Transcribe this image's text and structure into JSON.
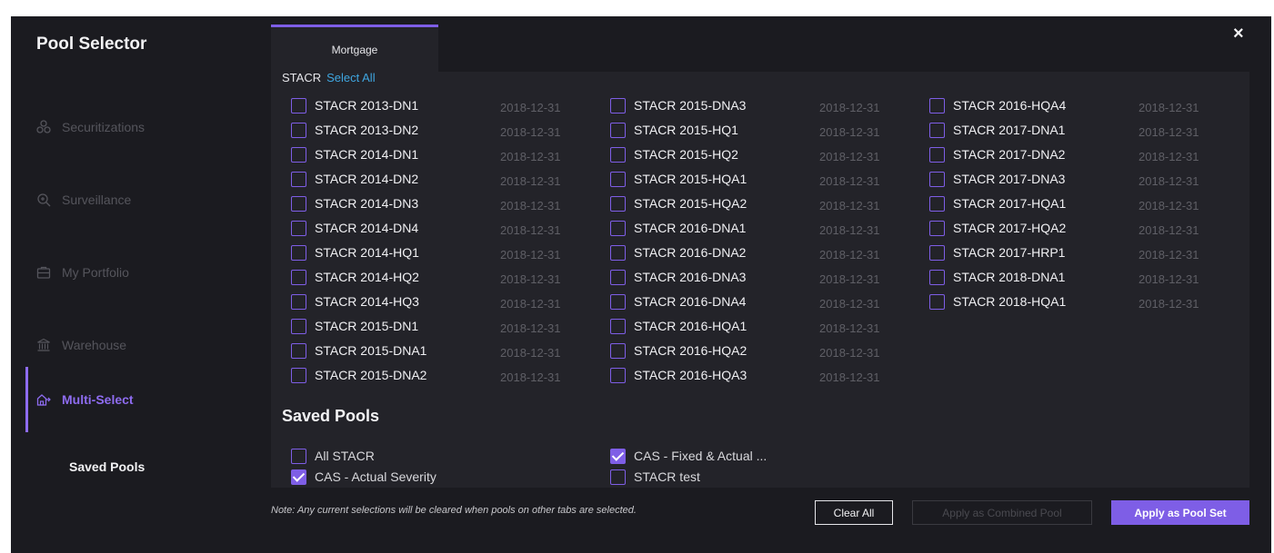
{
  "sidebar": {
    "title": "Pool Selector",
    "items": [
      {
        "label": "Securitizations",
        "icon": "share-nodes-icon"
      },
      {
        "label": "Surveillance",
        "icon": "magnifier-icon"
      },
      {
        "label": "My Portfolio",
        "icon": "briefcase-icon"
      },
      {
        "label": "Warehouse",
        "icon": "bank-icon"
      },
      {
        "label": "Multi-Select",
        "icon": "multi-select-icon",
        "active": true
      }
    ],
    "saved_pools_label": "Saved Pools"
  },
  "tab": {
    "label": "Mortgage"
  },
  "group": {
    "name": "STACR",
    "select_all": "Select All"
  },
  "pools": {
    "col1": [
      {
        "name": "STACR 2013-DN1",
        "date": "2018-12-31"
      },
      {
        "name": "STACR 2013-DN2",
        "date": "2018-12-31"
      },
      {
        "name": "STACR 2014-DN1",
        "date": "2018-12-31"
      },
      {
        "name": "STACR 2014-DN2",
        "date": "2018-12-31"
      },
      {
        "name": "STACR 2014-DN3",
        "date": "2018-12-31"
      },
      {
        "name": "STACR 2014-DN4",
        "date": "2018-12-31"
      },
      {
        "name": "STACR 2014-HQ1",
        "date": "2018-12-31"
      },
      {
        "name": "STACR 2014-HQ2",
        "date": "2018-12-31"
      },
      {
        "name": "STACR 2014-HQ3",
        "date": "2018-12-31"
      },
      {
        "name": "STACR 2015-DN1",
        "date": "2018-12-31"
      },
      {
        "name": "STACR 2015-DNA1",
        "date": "2018-12-31"
      },
      {
        "name": "STACR 2015-DNA2",
        "date": "2018-12-31"
      }
    ],
    "col2": [
      {
        "name": "STACR 2015-DNA3",
        "date": "2018-12-31"
      },
      {
        "name": "STACR 2015-HQ1",
        "date": "2018-12-31"
      },
      {
        "name": "STACR 2015-HQ2",
        "date": "2018-12-31"
      },
      {
        "name": "STACR 2015-HQA1",
        "date": "2018-12-31"
      },
      {
        "name": "STACR 2015-HQA2",
        "date": "2018-12-31"
      },
      {
        "name": "STACR 2016-DNA1",
        "date": "2018-12-31"
      },
      {
        "name": "STACR 2016-DNA2",
        "date": "2018-12-31"
      },
      {
        "name": "STACR 2016-DNA3",
        "date": "2018-12-31"
      },
      {
        "name": "STACR 2016-DNA4",
        "date": "2018-12-31"
      },
      {
        "name": "STACR 2016-HQA1",
        "date": "2018-12-31"
      },
      {
        "name": "STACR 2016-HQA2",
        "date": "2018-12-31"
      },
      {
        "name": "STACR 2016-HQA3",
        "date": "2018-12-31"
      }
    ],
    "col3": [
      {
        "name": "STACR 2016-HQA4",
        "date": "2018-12-31"
      },
      {
        "name": "STACR 2017-DNA1",
        "date": "2018-12-31"
      },
      {
        "name": "STACR 2017-DNA2",
        "date": "2018-12-31"
      },
      {
        "name": "STACR 2017-DNA3",
        "date": "2018-12-31"
      },
      {
        "name": "STACR 2017-HQA1",
        "date": "2018-12-31"
      },
      {
        "name": "STACR 2017-HQA2",
        "date": "2018-12-31"
      },
      {
        "name": "STACR 2017-HRP1",
        "date": "2018-12-31"
      },
      {
        "name": "STACR 2018-DNA1",
        "date": "2018-12-31"
      },
      {
        "name": "STACR 2018-HQA1",
        "date": "2018-12-31"
      }
    ]
  },
  "saved_pools": {
    "title": "Saved Pools",
    "col1": [
      {
        "name": "All STACR",
        "checked": false
      },
      {
        "name": "CAS - Actual Severity",
        "checked": true
      }
    ],
    "col2": [
      {
        "name": "CAS - Fixed & Actual ...",
        "checked": true
      },
      {
        "name": "STACR test",
        "checked": false
      }
    ]
  },
  "footer": {
    "note": "Note: Any current selections will be cleared when pools on other tabs are selected.",
    "clear_all": "Clear All",
    "apply_combined": "Apply as Combined Pool",
    "apply_pool_set": "Apply as Pool Set"
  },
  "close_glyph": "×",
  "colors": {
    "background": "#1b1b20",
    "panel": "#232329",
    "accent": "#7e5ee6",
    "link": "#3fa6e0"
  }
}
